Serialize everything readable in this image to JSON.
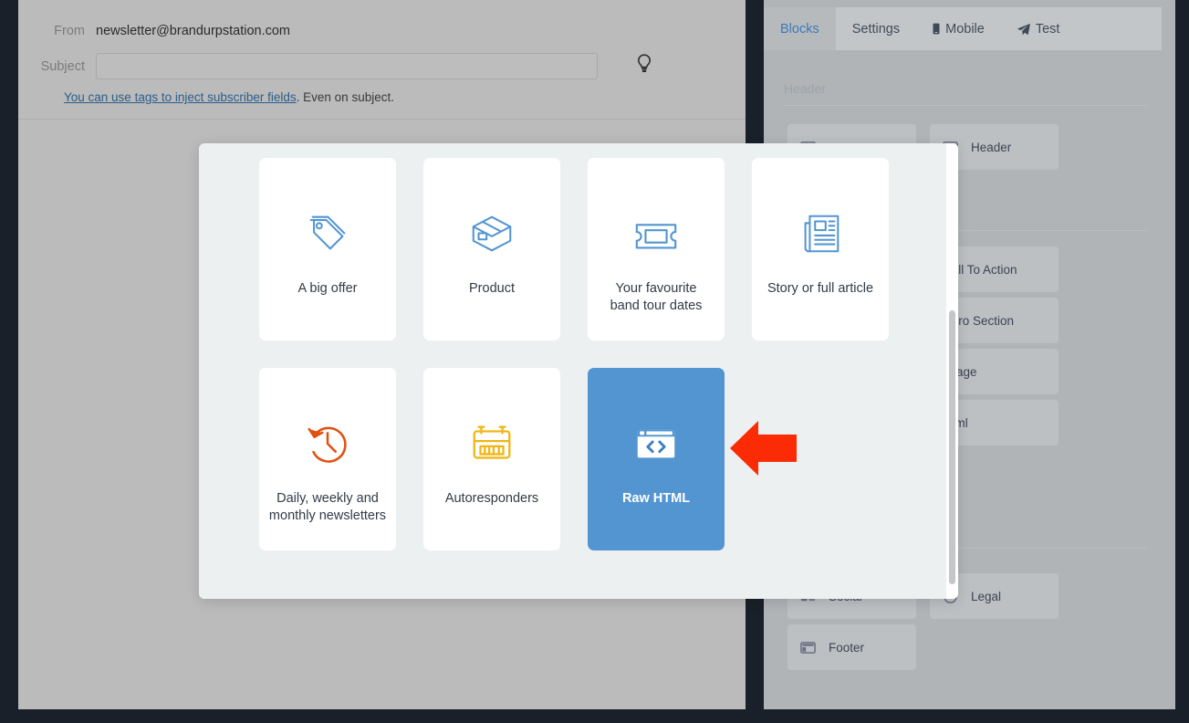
{
  "compose": {
    "from_label": "From",
    "from_value": "newsletter@brandurpstation.com",
    "subject_label": "Subject",
    "subject_value": "",
    "subject_placeholder": "",
    "hint_link": "You can use tags to inject subscriber fields",
    "hint_rest": ". Even on subject.",
    "bulb_icon": "lightbulb-icon"
  },
  "blocks_panel": {
    "tabs": [
      {
        "label": "Blocks",
        "icon": "",
        "active": true
      },
      {
        "label": "Settings",
        "icon": "",
        "active": false
      },
      {
        "label": "Mobile",
        "icon": "mobile-icon",
        "active": false
      },
      {
        "label": "Test",
        "icon": "paper-plane-icon",
        "active": false
      }
    ],
    "groups": [
      {
        "title": "Header"
      },
      {
        "title": ""
      },
      {
        "title": ""
      }
    ],
    "tiles": [
      {
        "label": "Header",
        "icon": "header-layout-icon"
      },
      {
        "label": "Call To Action",
        "icon": "cta-icon"
      },
      {
        "label": "Hero Section",
        "icon": "hero-icon"
      },
      {
        "label": "Image",
        "icon": "image-icon"
      },
      {
        "label": "Html",
        "icon": "html-icon"
      },
      {
        "label": "Legal",
        "icon": "legal-icon"
      },
      {
        "label": "Social",
        "icon": "social-icon"
      },
      {
        "label": "Footer",
        "icon": "footer-layout-icon"
      }
    ]
  },
  "modal": {
    "cards": [
      {
        "label": "A big offer",
        "icon": "price-tag-icon",
        "color": "#5295d1",
        "selected": false
      },
      {
        "label": "Product",
        "icon": "box-icon",
        "color": "#5295d1",
        "selected": false
      },
      {
        "label": "Your favourite\nband tour dates",
        "icon": "ticket-icon",
        "color": "#5295d1",
        "selected": false
      },
      {
        "label": "Story or full article",
        "icon": "newspaper-icon",
        "color": "#5295d1",
        "selected": false
      },
      {
        "label": "Daily, weekly and\nmonthly newsletters",
        "icon": "clock-rotate-icon",
        "color": "#e0500f",
        "selected": false
      },
      {
        "label": "Autoresponders",
        "icon": "calendar-icon",
        "color": "#f0b718",
        "selected": false
      },
      {
        "label": "Raw HTML",
        "icon": "code-window-icon",
        "color": "#ffffff",
        "selected": true
      }
    ],
    "selected_card": "Raw HTML",
    "scrollbar": "modal-scrollbar"
  },
  "annotation": {
    "arrow_icon": "left-pointing-arrow",
    "arrow_color": "#fb2b06"
  },
  "colors": {
    "accent_blue": "#5295d1",
    "tab_active": "#3d7ab5",
    "panel_gray": "#bbbbbb",
    "modal_bg": "#edf0f1",
    "dark_chrome": "#1a2029",
    "arrow_red": "#fb2b06"
  }
}
